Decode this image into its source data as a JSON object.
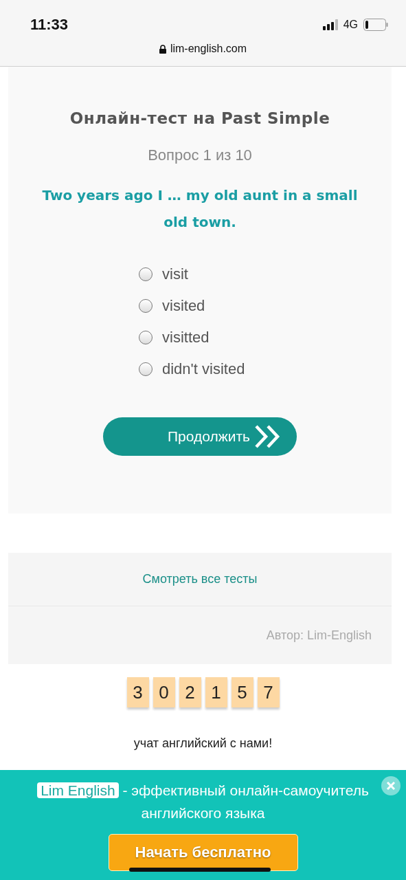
{
  "status_bar": {
    "time": "11:33",
    "network": "4G"
  },
  "address_bar": {
    "url": "lim-english.com"
  },
  "quiz": {
    "title": "Онлайн-тест на Past Simple",
    "progress": "Вопрос 1 из 10",
    "question": "Two years ago I … my old aunt in a small old town.",
    "options": [
      {
        "label": "visit",
        "selected": false
      },
      {
        "label": "visited",
        "selected": false
      },
      {
        "label": "visitted",
        "selected": false
      },
      {
        "label": "didn't visited",
        "selected": false
      }
    ],
    "continue_button": "Продолжить"
  },
  "footer": {
    "all_tests_link": "Смотреть все тесты",
    "author": "Автор: Lim-English"
  },
  "counter": {
    "digits": [
      "3",
      "0",
      "2",
      "1",
      "5",
      "7"
    ],
    "caption": "учат английский с нами!"
  },
  "banner": {
    "brand": "Lim English",
    "text": "- эффективный онлайн-самоучитель английского языка",
    "button": "Начать бесплатно"
  }
}
